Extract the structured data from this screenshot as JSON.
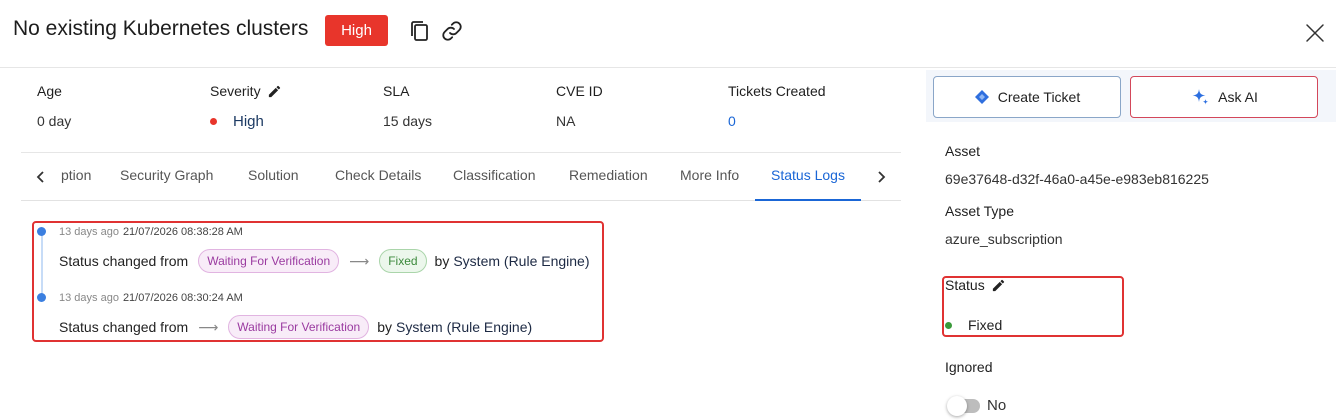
{
  "header": {
    "title": "No existing Kubernetes clusters",
    "severity_badge": "High",
    "badge_color": "#e8352b"
  },
  "info": {
    "age": {
      "label": "Age",
      "value": "0 day"
    },
    "severity": {
      "label": "Severity",
      "value": "High"
    },
    "sla": {
      "label": "SLA",
      "value": "15 days"
    },
    "cve": {
      "label": "CVE ID",
      "value": "NA"
    },
    "tickets": {
      "label": "Tickets Created",
      "value": "0"
    }
  },
  "tabs": [
    {
      "label": "ption",
      "active": false
    },
    {
      "label": "Security Graph",
      "active": false
    },
    {
      "label": "Solution",
      "active": false
    },
    {
      "label": "Check Details",
      "active": false
    },
    {
      "label": "Classification",
      "active": false
    },
    {
      "label": "Remediation",
      "active": false
    },
    {
      "label": "More Info",
      "active": false
    },
    {
      "label": "Status Logs",
      "active": true
    }
  ],
  "logs": [
    {
      "ago": "13 days ago",
      "timestamp": "21/07/2026 08:38:28 AM",
      "prefix": "Status changed from",
      "from": "Waiting For Verification",
      "to": "Fixed",
      "by": "by",
      "actor": "System (Rule Engine)"
    },
    {
      "ago": "13 days ago",
      "timestamp": "21/07/2026 08:30:24 AM",
      "prefix": "Status changed from",
      "to": "Waiting For Verification",
      "by": "by",
      "actor": "System (Rule Engine)"
    }
  ],
  "actions": {
    "create_ticket": "Create Ticket",
    "ask_ai": "Ask AI"
  },
  "details": {
    "asset_label": "Asset",
    "asset_value": "69e37648-d32f-46a0-a45e-e983eb816225",
    "asset_type_label": "Asset Type",
    "asset_type_value": "azure_subscription",
    "status_label": "Status",
    "status_value": "Fixed",
    "ignored_label": "Ignored",
    "ignored_value": "No"
  },
  "colors": {
    "accent": "#1a66d6",
    "danger": "#e8352b",
    "success": "#3a9a3a"
  }
}
